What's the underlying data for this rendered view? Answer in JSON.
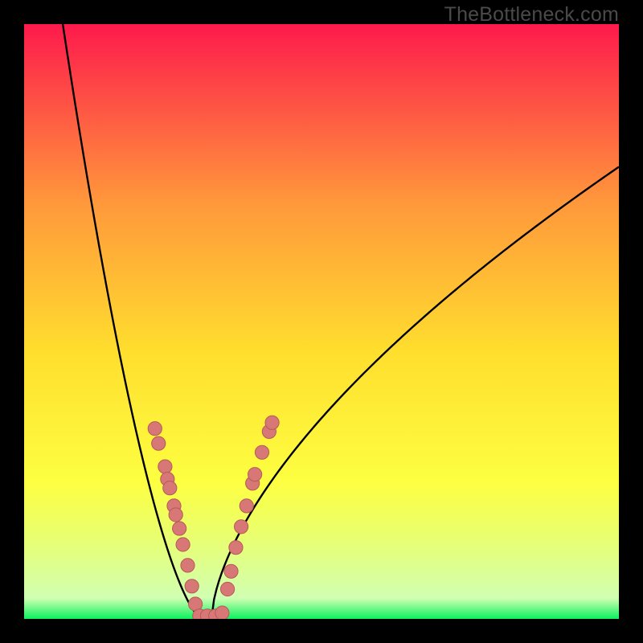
{
  "watermark": "TheBottleneck.com",
  "colors": {
    "gradient_top": "#fe1a4c",
    "gradient_mid_upper": "#ff983b",
    "gradient_mid": "#ffde2e",
    "gradient_mid_lower": "#fdff41",
    "gradient_band": "#e9ff6e",
    "gradient_bottom": "#0bf25e",
    "curve": "#000000",
    "dot_fill": "#d77876",
    "dot_stroke": "#b55a58",
    "frame": "#000000"
  },
  "chart_data": {
    "type": "line",
    "title": "",
    "xlabel": "",
    "ylabel": "",
    "xlim": [
      0,
      100
    ],
    "ylim": [
      0,
      100
    ],
    "curve": {
      "minimum_x": 30,
      "minimum_y": 0,
      "left_branch_top": {
        "x": 6.5,
        "y": 100
      },
      "right_branch_top": {
        "x": 100,
        "y": 76
      }
    },
    "gradient_stops": [
      {
        "offset": 0.0,
        "color": "#fe1a4c"
      },
      {
        "offset": 0.3,
        "color": "#ff983b"
      },
      {
        "offset": 0.55,
        "color": "#ffde2e"
      },
      {
        "offset": 0.77,
        "color": "#fdff41"
      },
      {
        "offset": 0.86,
        "color": "#e9ff6e"
      },
      {
        "offset": 0.965,
        "color": "#d1ffb2"
      },
      {
        "offset": 1.0,
        "color": "#0bf25e"
      }
    ],
    "series": [
      {
        "name": "dots-left-branch",
        "points": [
          {
            "x": 22.0,
            "y": 32.0
          },
          {
            "x": 22.6,
            "y": 29.5
          },
          {
            "x": 23.7,
            "y": 25.6
          },
          {
            "x": 24.1,
            "y": 23.5
          },
          {
            "x": 24.5,
            "y": 22.0
          },
          {
            "x": 25.2,
            "y": 19.0
          },
          {
            "x": 25.5,
            "y": 17.5
          },
          {
            "x": 26.1,
            "y": 15.2
          },
          {
            "x": 26.7,
            "y": 12.5
          },
          {
            "x": 27.5,
            "y": 9.0
          },
          {
            "x": 28.2,
            "y": 5.5
          },
          {
            "x": 28.8,
            "y": 2.5
          }
        ]
      },
      {
        "name": "dots-bottom",
        "points": [
          {
            "x": 29.5,
            "y": 0.5
          },
          {
            "x": 30.8,
            "y": 0.5
          },
          {
            "x": 32.2,
            "y": 0.5
          },
          {
            "x": 33.3,
            "y": 1.0
          }
        ]
      },
      {
        "name": "dots-right-branch",
        "points": [
          {
            "x": 34.2,
            "y": 5.0
          },
          {
            "x": 34.8,
            "y": 8.0
          },
          {
            "x": 35.6,
            "y": 12.0
          },
          {
            "x": 36.5,
            "y": 15.5
          },
          {
            "x": 37.4,
            "y": 19.0
          },
          {
            "x": 38.4,
            "y": 22.8
          },
          {
            "x": 38.8,
            "y": 24.3
          },
          {
            "x": 40.0,
            "y": 28.0
          },
          {
            "x": 41.2,
            "y": 31.5
          },
          {
            "x": 41.7,
            "y": 33.0
          }
        ]
      }
    ]
  }
}
